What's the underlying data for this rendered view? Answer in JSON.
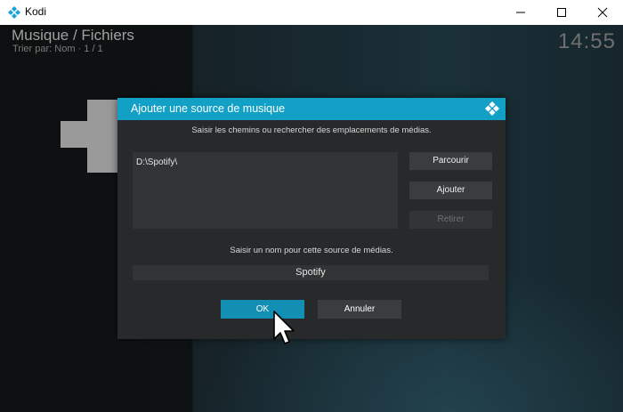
{
  "window": {
    "title": "Kodi",
    "icon": "kodi-logo-icon"
  },
  "header": {
    "title": "Musique / Fichiers",
    "subtitle": "Trier par: Nom  ·  1 / 1",
    "clock": "14:55"
  },
  "background": {
    "add_icon": "plus-icon"
  },
  "dialog": {
    "title": "Ajouter une source de musique",
    "logo_icon": "kodi-logo-icon",
    "paths_prompt": "Saisir les chemins ou rechercher des emplacements de médias.",
    "paths": [
      "D:\\Spotify\\"
    ],
    "browse_label": "Parcourir",
    "add_label": "Ajouter",
    "remove_label": "Retirer",
    "name_prompt": "Saisir un nom pour cette source de médias.",
    "name_value": "Spotify",
    "ok_label": "OK",
    "cancel_label": "Annuler"
  },
  "colors": {
    "accent": "#12a0c7",
    "ok_button": "#128fb3",
    "dialog_bg": "#27292b"
  }
}
